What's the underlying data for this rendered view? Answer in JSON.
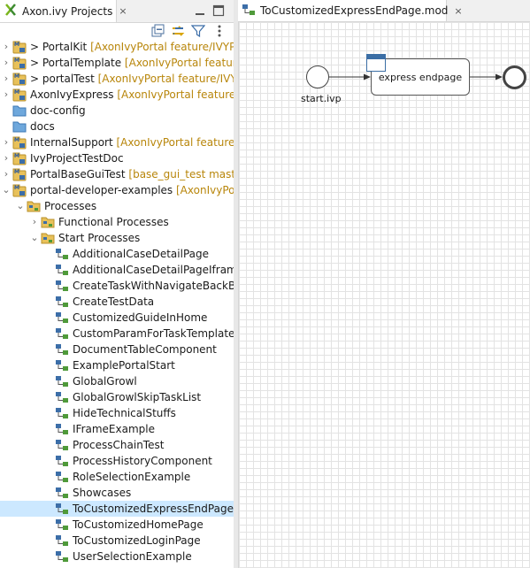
{
  "left_view": {
    "tab_title": "Axon.ivy Projects",
    "close_glyph": "×",
    "icons": {
      "tab": "axon-ivy-project-icon",
      "minimize": "minimize-icon",
      "maximize": "maximize-icon",
      "collapse_all": "collapse-all-icon",
      "link_with_editor": "link-with-editor-icon",
      "filter": "filter-icon",
      "view_menu": "view-menu-icon"
    }
  },
  "tree": [
    {
      "label": "> PortalKit",
      "decoration": " [AxonIvyPortal feature/IVYPORT",
      "expanded": false,
      "twisty": true,
      "icon": "project-icon"
    },
    {
      "label": "> PortalTemplate",
      "decoration": " [AxonIvyPortal feature/IV",
      "expanded": false,
      "twisty": true,
      "icon": "project-icon"
    },
    {
      "label": "> portalTest",
      "decoration": " [AxonIvyPortal feature/IVYPOR",
      "expanded": false,
      "twisty": true,
      "icon": "project-icon"
    },
    {
      "label": "AxonIvyExpress",
      "decoration": " [AxonIvyPortal feature/IVY",
      "expanded": false,
      "twisty": true,
      "icon": "project-icon"
    },
    {
      "label": "doc-config",
      "decoration": "",
      "expanded": false,
      "twisty": false,
      "icon": "folder-icon"
    },
    {
      "label": "docs",
      "decoration": "",
      "expanded": false,
      "twisty": false,
      "icon": "folder-icon"
    },
    {
      "label": "InternalSupport",
      "decoration": " [AxonIvyPortal feature/IVY",
      "expanded": false,
      "twisty": true,
      "icon": "project-icon"
    },
    {
      "label": "IvyProjectTestDoc",
      "decoration": "",
      "expanded": false,
      "twisty": true,
      "icon": "project-icon"
    },
    {
      "label": "PortalBaseGuiTest",
      "decoration": " [base_gui_test master]",
      "expanded": false,
      "twisty": true,
      "icon": "project-icon"
    },
    {
      "label": "portal-developer-examples",
      "decoration": " [AxonIvyPortal",
      "expanded": true,
      "twisty": true,
      "icon": "project-icon"
    },
    {
      "label": "Processes",
      "decoration": "",
      "expanded": true,
      "twisty": true,
      "icon": "process-folder-icon"
    },
    {
      "label": "Functional Processes",
      "decoration": "",
      "expanded": false,
      "twisty": true,
      "icon": "process-folder-icon"
    },
    {
      "label": "Start Processes",
      "decoration": "",
      "expanded": true,
      "twisty": true,
      "icon": "process-folder-icon"
    },
    {
      "label": "AdditionalCaseDetailPage",
      "decoration": "",
      "twisty": false,
      "icon": "process-icon"
    },
    {
      "label": "AdditionalCaseDetailPageIframe",
      "decoration": "",
      "twisty": false,
      "icon": "process-icon"
    },
    {
      "label": "CreateTaskWithNavigateBackButt",
      "decoration": "",
      "twisty": false,
      "icon": "process-icon"
    },
    {
      "label": "CreateTestData",
      "decoration": "",
      "twisty": false,
      "icon": "process-icon"
    },
    {
      "label": "CustomizedGuideInHome",
      "decoration": "",
      "twisty": false,
      "icon": "process-icon"
    },
    {
      "label": "CustomParamForTaskTemplates",
      "decoration": "",
      "twisty": false,
      "icon": "process-icon"
    },
    {
      "label": "DocumentTableComponent",
      "decoration": "",
      "twisty": false,
      "icon": "process-icon"
    },
    {
      "label": "ExamplePortalStart",
      "decoration": "",
      "twisty": false,
      "icon": "process-icon"
    },
    {
      "label": "GlobalGrowl",
      "decoration": "",
      "twisty": false,
      "icon": "process-icon"
    },
    {
      "label": "GlobalGrowlSkipTaskList",
      "decoration": "",
      "twisty": false,
      "icon": "process-icon"
    },
    {
      "label": "HideTechnicalStuffs",
      "decoration": "",
      "twisty": false,
      "icon": "process-icon"
    },
    {
      "label": "IFrameExample",
      "decoration": "",
      "twisty": false,
      "icon": "process-icon"
    },
    {
      "label": "ProcessChainTest",
      "decoration": "",
      "twisty": false,
      "icon": "process-icon"
    },
    {
      "label": "ProcessHistoryComponent",
      "decoration": "",
      "twisty": false,
      "icon": "process-icon"
    },
    {
      "label": "RoleSelectionExample",
      "decoration": "",
      "twisty": false,
      "icon": "process-icon"
    },
    {
      "label": "Showcases",
      "decoration": "",
      "twisty": false,
      "icon": "process-icon"
    },
    {
      "label": "ToCustomizedExpressEndPage",
      "decoration": "",
      "twisty": false,
      "icon": "process-icon",
      "selected": true
    },
    {
      "label": "ToCustomizedHomePage",
      "decoration": "",
      "twisty": false,
      "icon": "process-icon"
    },
    {
      "label": "ToCustomizedLoginPage",
      "decoration": "",
      "twisty": false,
      "icon": "process-icon"
    },
    {
      "label": "UserSelectionExample",
      "decoration": "",
      "twisty": false,
      "icon": "process-icon"
    }
  ],
  "editor": {
    "tab_title": "ToCustomizedExpressEndPage.mod",
    "close_glyph": "×",
    "tab_icon": "process-model-icon",
    "diagram": {
      "start_label": "start.ivp",
      "process_label": "express endpage",
      "process_icon": "window-icon"
    }
  },
  "colors": {
    "selection": "#cce8ff",
    "decoration": "#b8860b",
    "grid": "#e3e3e3",
    "accent": "#3b6ea5"
  }
}
